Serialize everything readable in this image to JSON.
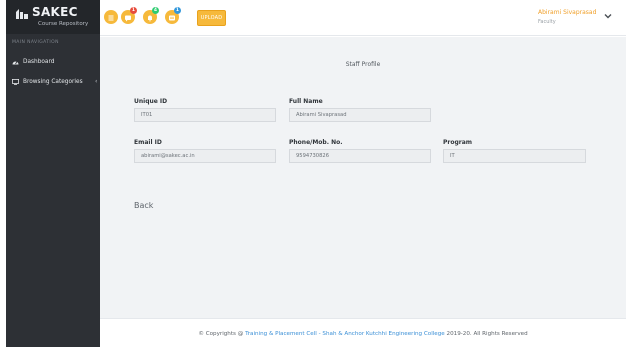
{
  "brand": {
    "name": "SAKEC",
    "tagline": "Course Repository"
  },
  "sidebar": {
    "heading": "MAIN NAVIGATION",
    "items": [
      {
        "label": "Dashboard",
        "icon": "dashboard-icon"
      },
      {
        "label": "Browsing Categories",
        "icon": "monitor-icon",
        "chevron": "‹"
      }
    ]
  },
  "topbar": {
    "badges": [
      "1",
      "4",
      "1"
    ],
    "upload_label": "UPLOAD",
    "user_name": "Abirami Sivaprasad",
    "user_role": "Faculty"
  },
  "profile": {
    "title": "Staff Profile",
    "fields": {
      "unique_id": {
        "label": "Unique ID",
        "value": "IT01"
      },
      "full_name": {
        "label": "Full Name",
        "value": "Abirami Sivaprasad"
      },
      "email": {
        "label": "Email ID",
        "value": "abirami@sakec.ac.in"
      },
      "phone": {
        "label": "Phone/Mob. No.",
        "value": "9594730826"
      },
      "program": {
        "label": "Program",
        "value": "IT"
      }
    },
    "back_label": "Back"
  },
  "footer": {
    "prefix": "© Copyrights @",
    "link_text": "Training & Placement Cell - Shah & Anchor Kutchhi Engineering College",
    "suffix": "2019-20. All Rights Reserved"
  },
  "colors": {
    "sidebar_bg": "#2d3035",
    "accent_orange": "#f6b93b",
    "badge_red": "#e74c3c",
    "badge_green": "#2ecc71",
    "badge_blue": "#3498db",
    "link_blue": "#3a8fd6"
  }
}
